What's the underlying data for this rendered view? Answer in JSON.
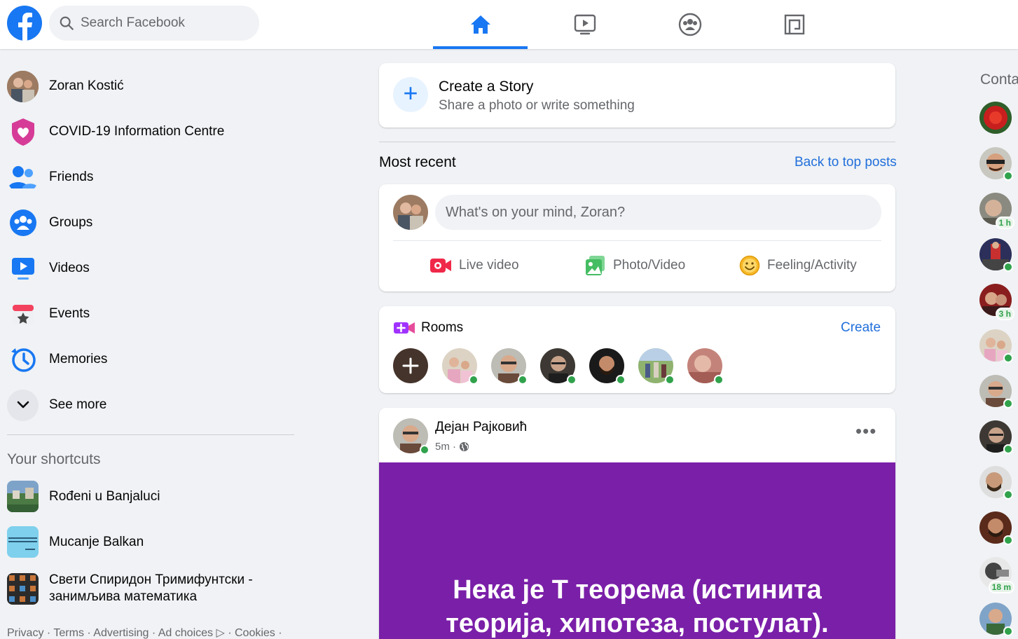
{
  "topbar": {
    "search_placeholder": "Search Facebook",
    "nav": [
      "home-icon",
      "watch-icon",
      "groups-icon",
      "gaming-icon"
    ],
    "active_nav": "home"
  },
  "sidebar": {
    "items": [
      {
        "label": "Zoran Kostić",
        "icon": "profile-avatar"
      },
      {
        "label": "COVID-19 Information Centre",
        "icon": "covid-heart-icon"
      },
      {
        "label": "Friends",
        "icon": "friends-icon"
      },
      {
        "label": "Groups",
        "icon": "groups-icon"
      },
      {
        "label": "Videos",
        "icon": "videos-icon"
      },
      {
        "label": "Events",
        "icon": "events-icon"
      },
      {
        "label": "Memories",
        "icon": "memories-icon"
      },
      {
        "label": "See more",
        "icon": "chevron-down-icon"
      }
    ],
    "shortcuts_title": "Your shortcuts",
    "shortcuts": [
      {
        "label": "Rođeni u Banjaluci"
      },
      {
        "label": "Mucanje Balkan"
      },
      {
        "label": "Свети Спиридон Тримифунтски - занимљива математика"
      }
    ],
    "footer": "Privacy · Terms · Advertising · Ad choices ▷ · Cookies ·"
  },
  "story": {
    "title": "Create a Story",
    "subtitle": "Share a photo or write something"
  },
  "feed": {
    "most_recent": "Most recent",
    "back_to_top": "Back to top posts"
  },
  "composer": {
    "placeholder": "What's on your mind, Zoran?",
    "actions": [
      {
        "label": "Live video",
        "icon": "live-video-icon",
        "color": "#f02849"
      },
      {
        "label": "Photo/Video",
        "icon": "photo-video-icon",
        "color": "#45bd62"
      },
      {
        "label": "Feeling/Activity",
        "icon": "feeling-icon",
        "color": "#f7b928"
      }
    ]
  },
  "rooms": {
    "title": "Rooms",
    "create": "Create"
  },
  "post": {
    "author": "Дејан Рајковић",
    "time": "5m ·",
    "body_line1": "Нека је Т теорема (истинита",
    "body_line2": "теорија, хипотеза, постулат).",
    "bg_color": "#7a1fa8"
  },
  "contacts": {
    "title": "Conta",
    "badges": [
      "1 h",
      "3 h",
      "18 m"
    ]
  },
  "colors": {
    "brand": "#1877f2",
    "link": "#216fdb",
    "online": "#31a24c"
  }
}
